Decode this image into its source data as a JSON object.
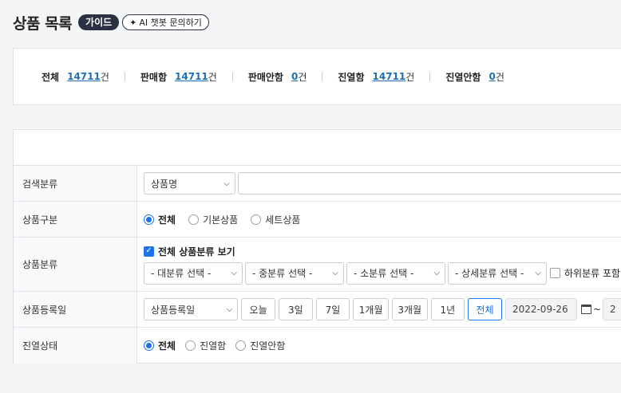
{
  "header": {
    "title": "상품 목록",
    "guide_label": "가이드",
    "ai_label": "AI 챗봇 문의하기"
  },
  "summary": [
    {
      "label": "전체",
      "count": "14711",
      "unit": "건"
    },
    {
      "label": "판매함",
      "count": "14711",
      "unit": "건"
    },
    {
      "label": "판매안함",
      "count": "0",
      "unit": "건"
    },
    {
      "label": "진열함",
      "count": "14711",
      "unit": "건"
    },
    {
      "label": "진열안함",
      "count": "0",
      "unit": "건"
    }
  ],
  "search": {
    "category": {
      "label": "검색분류",
      "select_value": "상품명",
      "input_value": ""
    },
    "type": {
      "label": "상품구분",
      "options": [
        "전체",
        "기본상품",
        "세트상품"
      ],
      "selected": "전체"
    },
    "classification": {
      "label": "상품분류",
      "show_all_label": "전체 상품분류 보기",
      "selects": [
        "- 대분류 선택 -",
        "- 중분류 선택 -",
        "- 소분류 선택 -",
        "- 상세분류 선택 -"
      ],
      "include_sub_label": "하위분류 포함"
    },
    "reg_date": {
      "label": "상품등록일",
      "select_value": "상품등록일",
      "periods": [
        "오늘",
        "3일",
        "7일",
        "1개월",
        "3개월",
        "1년",
        "전체"
      ],
      "active_period": "전체",
      "start_date": "2022-09-26",
      "tilde": "~",
      "end_date_partial": "2"
    },
    "display": {
      "label": "진열상태",
      "options": [
        "전체",
        "진열함",
        "진열안함"
      ],
      "selected": "전체"
    }
  }
}
